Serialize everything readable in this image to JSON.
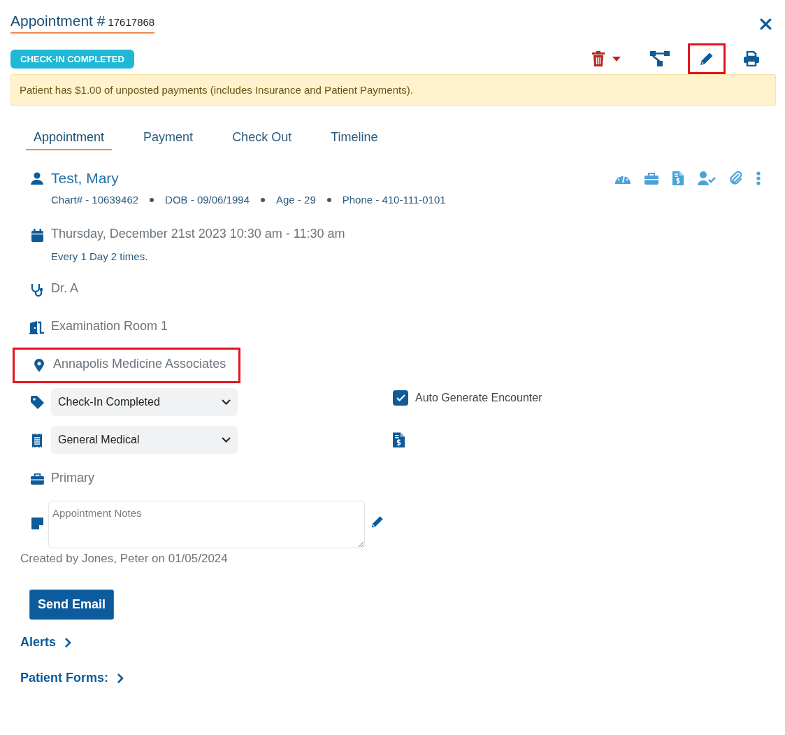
{
  "header": {
    "title": "Appointment #",
    "number": "17617868"
  },
  "status_badge": "CHECK-IN COMPLETED",
  "toolbar": [
    {
      "kind": "delete",
      "highlighted": false
    },
    {
      "kind": "workflow",
      "highlighted": false
    },
    {
      "kind": "edit",
      "highlighted": true
    },
    {
      "kind": "print",
      "highlighted": false
    }
  ],
  "alert": "Patient has $1.00 of unposted payments (includes Insurance and Patient Payments).",
  "tabs": [
    {
      "label": "Appointment",
      "selected": true
    },
    {
      "label": "Payment",
      "selected": false
    },
    {
      "label": "Check Out",
      "selected": false
    },
    {
      "label": "Timeline",
      "selected": false
    }
  ],
  "patient": {
    "name": "Test, Mary",
    "details": [
      "Chart# - 10639462",
      "DOB - 09/06/1994",
      "Age - 29",
      "Phone - 410-111-0101"
    ],
    "actions": [
      {
        "kind": "gauge"
      },
      {
        "kind": "briefcase"
      },
      {
        "kind": "invoice"
      },
      {
        "kind": "user-check"
      },
      {
        "kind": "paperclip"
      },
      {
        "kind": "more"
      }
    ]
  },
  "schedule": {
    "datetime": "Thursday, December 21st 2023 10:30 am - 11:30 am",
    "recurrence": "Every 1 Day 2 times."
  },
  "provider": "Dr. A",
  "room": "Examination Room 1",
  "location": {
    "name": "Annapolis Medicine Associates",
    "highlighted": true
  },
  "status_select": {
    "value": "Check-In Completed"
  },
  "auto_generate": {
    "label": "Auto Generate Encounter",
    "checked": true
  },
  "visit_type_select": {
    "value": "General Medical"
  },
  "insurance": "Primary",
  "notes": {
    "placeholder": "Appointment Notes"
  },
  "created_by": "Created by Jones, Peter on 01/05/2024",
  "send_email_button": "Send Email",
  "sections": [
    {
      "label": "Alerts",
      "expanded": false
    },
    {
      "label": "Patient Forms:",
      "expanded": false
    }
  ]
}
